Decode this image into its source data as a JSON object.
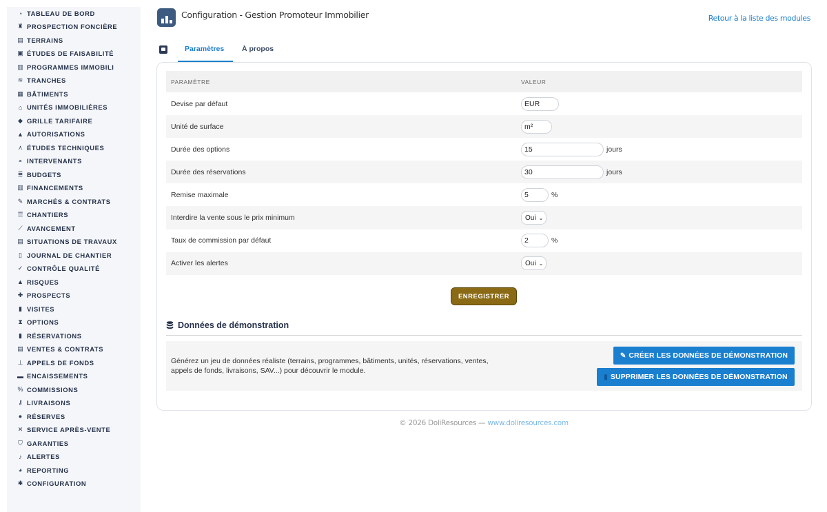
{
  "sidebar": {
    "items": [
      {
        "label": "TABLEAU DE BORD",
        "icon": "dashboard-icon"
      },
      {
        "label": "PROSPECTION FONCIÈRE",
        "icon": "binoculars-icon"
      },
      {
        "label": "TERRAINS",
        "icon": "map-icon"
      },
      {
        "label": "ÉTUDES DE FAISABILITÉ",
        "icon": "clipboard-icon"
      },
      {
        "label": "PROGRAMMES IMMOBILI",
        "icon": "buildings-icon"
      },
      {
        "label": "TRANCHES",
        "icon": "layers-icon"
      },
      {
        "label": "BÂTIMENTS",
        "icon": "building-icon"
      },
      {
        "label": "UNITÉS IMMOBILIÈRES",
        "icon": "home-icon"
      },
      {
        "label": "GRILLE TARIFAIRE",
        "icon": "tags-icon"
      },
      {
        "label": "AUTORISATIONS",
        "icon": "stamp-icon"
      },
      {
        "label": "ÉTUDES TECHNIQUES",
        "icon": "compass-icon"
      },
      {
        "label": "INTERVENANTS",
        "icon": "hard-hat-icon"
      },
      {
        "label": "BUDGETS",
        "icon": "coins-icon"
      },
      {
        "label": "FINANCEMENTS",
        "icon": "bank-icon"
      },
      {
        "label": "MARCHÉS & CONTRATS",
        "icon": "contract-icon"
      },
      {
        "label": "CHANTIERS",
        "icon": "list-icon"
      },
      {
        "label": "AVANCEMENT",
        "icon": "chart-line-icon"
      },
      {
        "label": "SITUATIONS DE TRAVAUX",
        "icon": "invoice-icon"
      },
      {
        "label": "JOURNAL DE CHANTIER",
        "icon": "book-icon"
      },
      {
        "label": "CONTRÔLE QUALITÉ",
        "icon": "check-double-icon"
      },
      {
        "label": "RISQUES",
        "icon": "warning-icon"
      },
      {
        "label": "PROSPECTS",
        "icon": "user-plus-icon"
      },
      {
        "label": "VISITES",
        "icon": "door-icon"
      },
      {
        "label": "OPTIONS",
        "icon": "hourglass-icon"
      },
      {
        "label": "RÉSERVATIONS",
        "icon": "bookmark-icon"
      },
      {
        "label": "VENTES & CONTRATS",
        "icon": "file-contract-icon"
      },
      {
        "label": "APPELS DE FONDS",
        "icon": "hand-coins-icon"
      },
      {
        "label": "ENCAISSEMENTS",
        "icon": "money-icon"
      },
      {
        "label": "COMMISSIONS",
        "icon": "percent-icon"
      },
      {
        "label": "LIVRAISONS",
        "icon": "key-icon"
      },
      {
        "label": "RÉSERVES",
        "icon": "exclamation-circle-icon"
      },
      {
        "label": "SERVICE APRÈS-VENTE",
        "icon": "tools-icon"
      },
      {
        "label": "GARANTIES",
        "icon": "shield-icon"
      },
      {
        "label": "ALERTES",
        "icon": "bell-icon"
      },
      {
        "label": "REPORTING",
        "icon": "pie-chart-icon"
      },
      {
        "label": "CONFIGURATION",
        "icon": "gear-icon"
      }
    ]
  },
  "header": {
    "title": "Configuration - Gestion Promoteur Immobilier",
    "back_link": "Retour à la liste des modules"
  },
  "tabs": [
    {
      "label": "Paramètres",
      "active": true
    },
    {
      "label": "À propos",
      "active": false
    }
  ],
  "table": {
    "col_param": "PARAMÈTRE",
    "col_value": "VALEUR",
    "rows": [
      {
        "label": "Devise par défaut",
        "value": "EUR",
        "unit": "",
        "kind": "input"
      },
      {
        "label": "Unité de surface",
        "value": "m²",
        "unit": "",
        "kind": "input"
      },
      {
        "label": "Durée des options",
        "value": "15",
        "unit": "jours",
        "kind": "input"
      },
      {
        "label": "Durée des réservations",
        "value": "30",
        "unit": "jours",
        "kind": "input"
      },
      {
        "label": "Remise maximale",
        "value": "5",
        "unit": "%",
        "kind": "input"
      },
      {
        "label": "Interdire la vente sous le prix minimum",
        "value": "Oui",
        "unit": "",
        "kind": "select"
      },
      {
        "label": "Taux de commission par défaut",
        "value": "2",
        "unit": "%",
        "kind": "input"
      },
      {
        "label": "Activer les alertes",
        "value": "Oui",
        "unit": "",
        "kind": "select"
      }
    ]
  },
  "save_label": "ENREGISTRER",
  "demo": {
    "title": "Données de démonstration",
    "description": "Générez un jeu de données réaliste (terrains, programmes, bâtiments, unités, réservations, ventes, appels de fonds, livraisons, SAV...) pour découvrir le module.",
    "create_label": "CRÉER LES DONNÉES DE DÉMONSTRATION",
    "delete_label": "SUPPRIMER LES DONNÉES DE DÉMONSTRATION"
  },
  "footer": {
    "copyright": "© 2026 DoliResources — ",
    "link": "www.doliresources.com"
  },
  "colors": {
    "accent": "#1b7fcc",
    "save_button": "#8a6a14",
    "demo_button": "#1b7fd0",
    "sidebar_bg": "#f4f6f9"
  }
}
